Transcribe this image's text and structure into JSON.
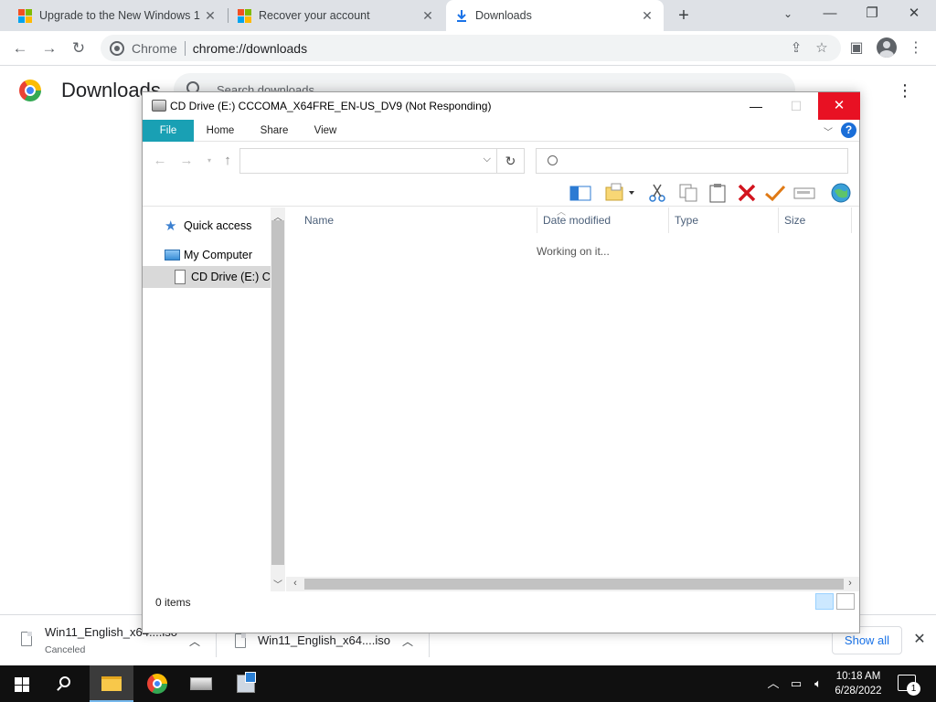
{
  "browser": {
    "tabs": [
      {
        "title": "Upgrade to the New Windows 1",
        "icon": "microsoft-logo-icon",
        "active": false
      },
      {
        "title": "Recover your account",
        "icon": "microsoft-logo-icon",
        "active": false
      },
      {
        "title": "Downloads",
        "icon": "download-icon",
        "active": true
      }
    ],
    "new_tab_glyph": "+",
    "site_label": "Chrome",
    "url": "chrome://downloads"
  },
  "downloads_page": {
    "heading": "Downloads",
    "search_placeholder": "Search downloads"
  },
  "explorer": {
    "title": "CD Drive (E:) CCCOMA_X64FRE_EN-US_DV9 (Not Responding)",
    "ribbon_tabs": [
      "File",
      "Home",
      "Share",
      "View"
    ],
    "help_glyph": "?",
    "nav_items": [
      {
        "label": "Quick access",
        "icon": "star-icon"
      },
      {
        "label": "My Computer",
        "icon": "computer-icon"
      },
      {
        "label": "CD Drive (E:) CC",
        "icon": "document-icon",
        "selected": true
      }
    ],
    "columns": [
      "Name",
      "Date modified",
      "Type",
      "Size"
    ],
    "working_message": "Working on it...",
    "status": "0 items"
  },
  "download_shelf": {
    "items": [
      {
        "name": "Win11_English_x64....iso",
        "status": "Canceled"
      },
      {
        "name": "Win11_English_x64....iso",
        "status": ""
      }
    ],
    "show_all": "Show all"
  },
  "taskbar": {
    "time": "10:18 AM",
    "date": "6/28/2022",
    "notification_count": "1"
  },
  "colors": {
    "ribbon_file_tab": "#19a0b4",
    "close_button": "#e81123",
    "link_blue": "#1a73e8"
  }
}
